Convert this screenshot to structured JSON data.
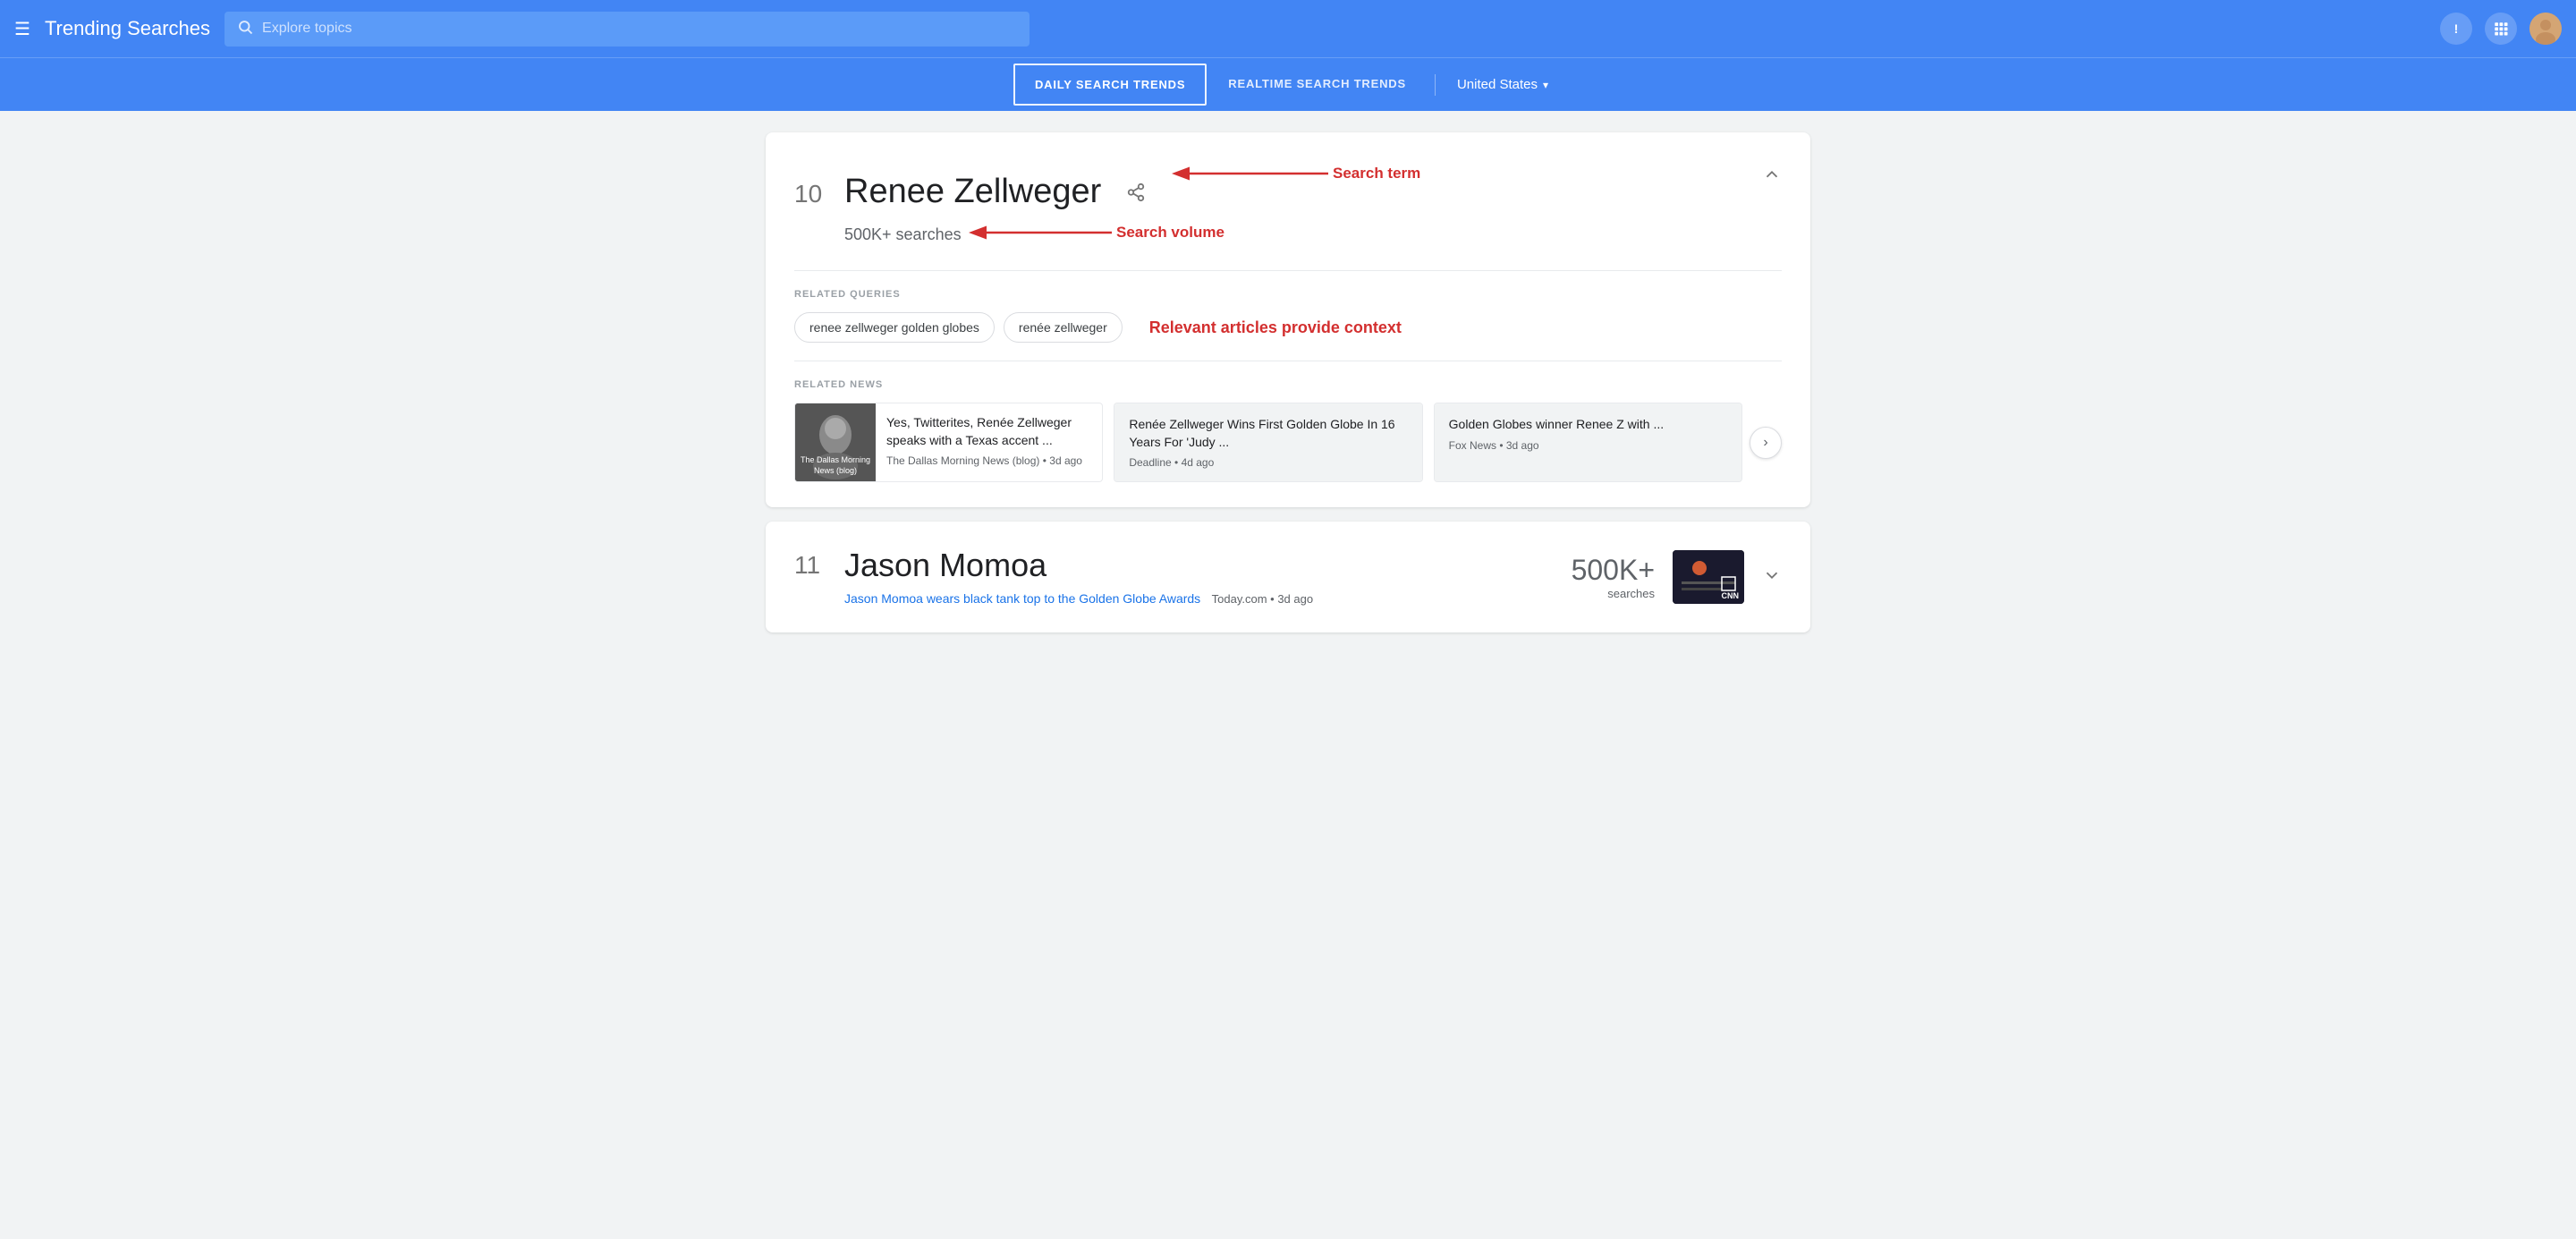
{
  "header": {
    "menu_icon": "☰",
    "title": "Trending Searches",
    "search_placeholder": "Explore topics",
    "feedback_icon": "!",
    "apps_icon": "⋮⋮⋮",
    "avatar_label": "User avatar"
  },
  "nav": {
    "daily_label": "DAILY SEARCH TRENDS",
    "realtime_label": "REALTIME SEARCH TRENDS",
    "country": "United States"
  },
  "result_10": {
    "rank": "10",
    "title": "Renee Zellweger",
    "volume": "500K+ searches",
    "annotation_search_term": "Search term",
    "annotation_search_volume": "Search volume",
    "annotation_articles": "Relevant articles provide context",
    "related_queries_label": "RELATED QUERIES",
    "chips": [
      "renee zellweger golden globes",
      "renée zellweger"
    ],
    "related_news_label": "RELATED NEWS",
    "news": [
      {
        "img_label": "The Dallas Morning News (blog)",
        "title": "Yes, Twitterites, Renée Zellweger speaks with a Texas accent ...",
        "source": "The Dallas Morning News (blog)",
        "time": "3d ago"
      },
      {
        "img_label": "",
        "title": "Renée Zellweger Wins First Golden Globe In 16 Years For 'Judy ...",
        "source": "Deadline",
        "time": "4d ago"
      },
      {
        "img_label": "",
        "title": "Golden Globes winner Renee Z with ...",
        "source": "Fox News",
        "time": "3d ago"
      }
    ]
  },
  "result_11": {
    "rank": "11",
    "title": "Jason Momoa",
    "news_title": "Jason Momoa wears black tank top to the Golden Globe Awards",
    "news_source": "Today.com",
    "news_time": "3d ago",
    "volume_large": "500K+",
    "volume_small": "searches",
    "img_label": "CNN"
  },
  "colors": {
    "accent": "#4285f4",
    "red": "#d32f2f",
    "text_primary": "#202124",
    "text_secondary": "#5f6368"
  }
}
